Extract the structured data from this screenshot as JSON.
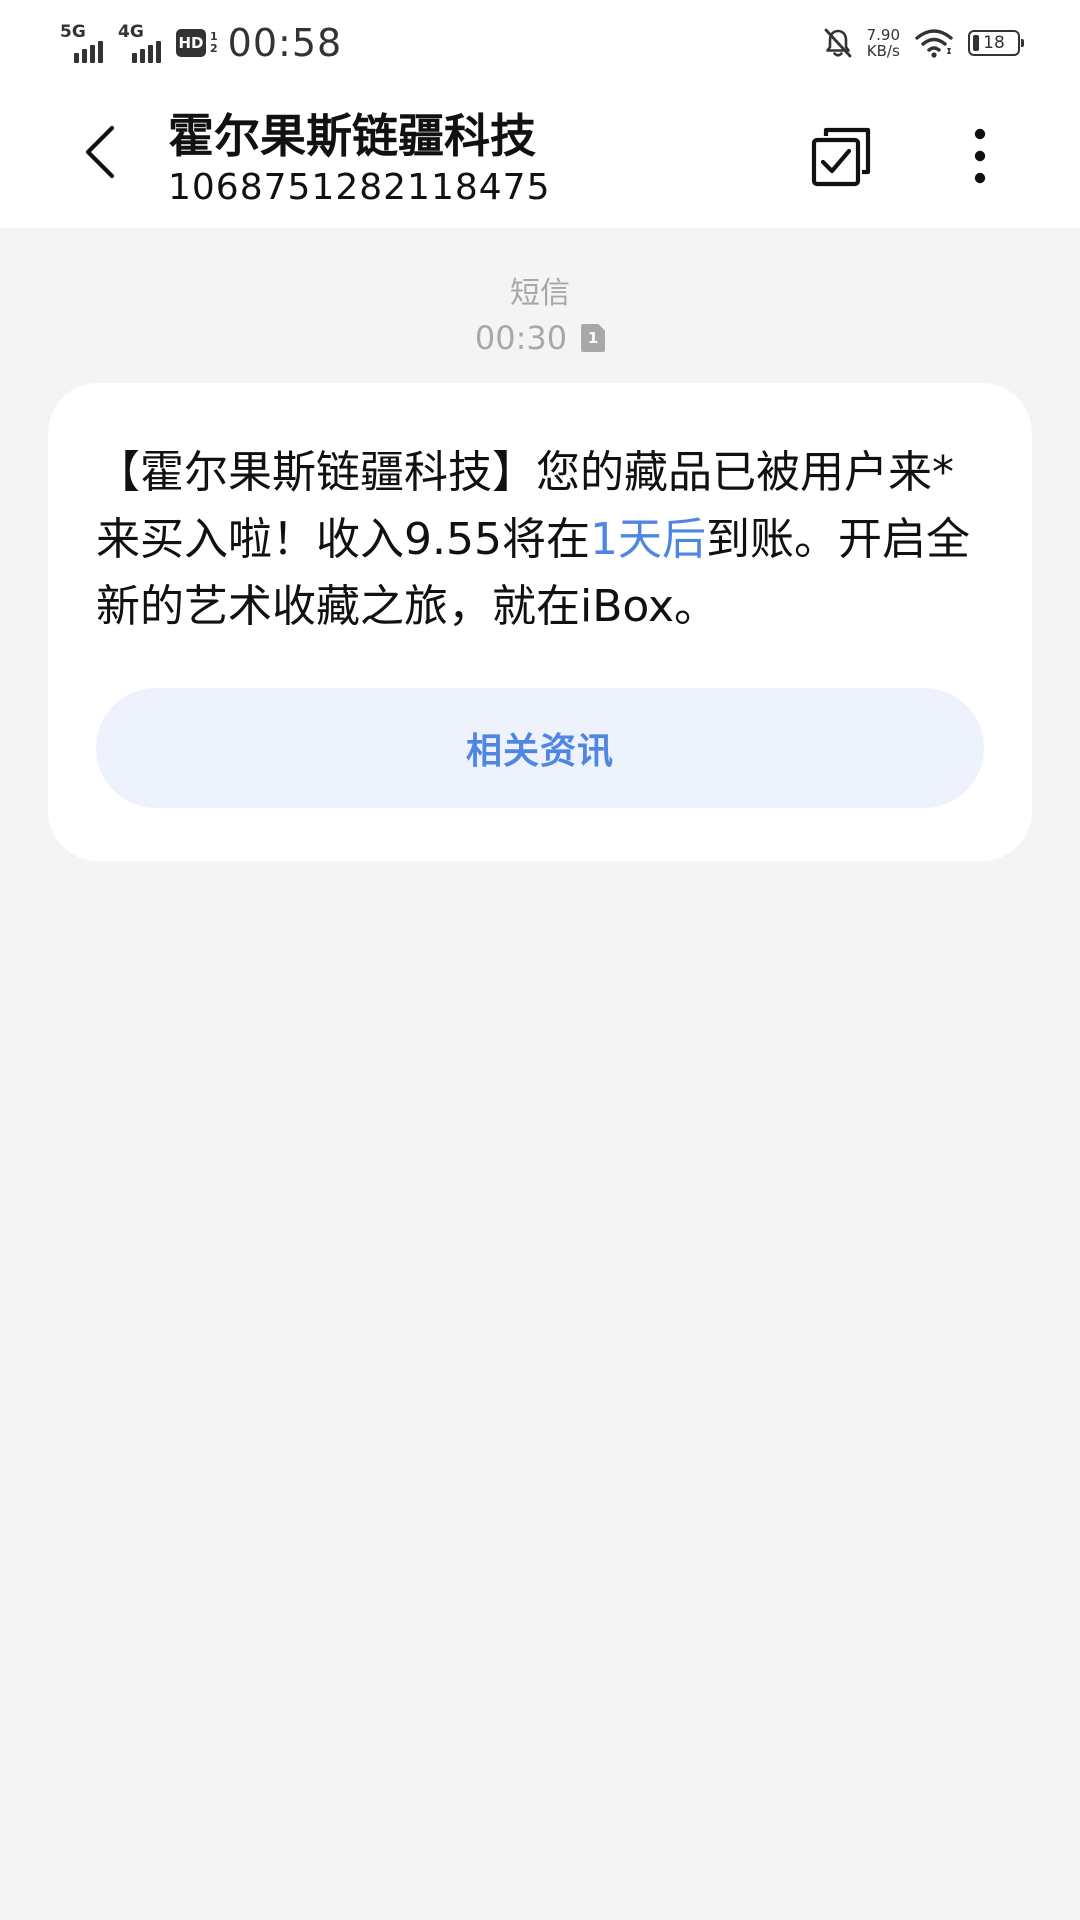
{
  "status_bar": {
    "network_1": "5G",
    "network_2": "4G",
    "hd_label": "HD",
    "hd_top": "1",
    "hd_bottom": "2",
    "time": "00:58",
    "speed_value": "7.90",
    "speed_unit": "KB/s",
    "battery": "18"
  },
  "header": {
    "title": "霍尔果斯链疆科技",
    "phone_number": "1068751282118475"
  },
  "message_meta": {
    "type": "短信",
    "time": "00:30",
    "sim": "1"
  },
  "message": {
    "text_before": "【霍尔果斯链疆科技】您的藏品已被用户来*来买入啦！收入9.55将在",
    "link_text": "1天后",
    "text_after": "到账。开启全新的艺术收藏之旅，就在iBox。",
    "button_label": "相关资讯"
  },
  "colors": {
    "accent": "#4f86e2",
    "button_bg": "#edf2fc",
    "page_bg": "#f4f4f4",
    "meta_gray": "#a8a8a8"
  }
}
